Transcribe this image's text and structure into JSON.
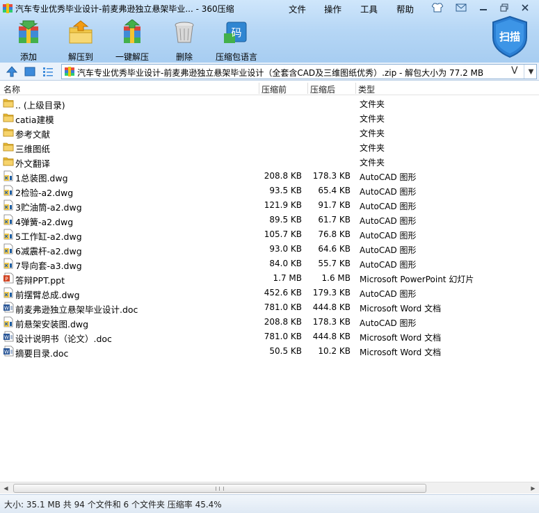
{
  "window": {
    "title": "汽车专业优秀毕业设计-前麦弗逊独立悬架毕业... - 360压缩",
    "menus": [
      "文件",
      "操作",
      "工具",
      "帮助"
    ]
  },
  "toolbar": {
    "add_label": "添加",
    "extract_to_label": "解压到",
    "one_click_label": "一键解压",
    "delete_label": "删除",
    "lang_label": "压缩包语言",
    "lang_icon_text": "码",
    "scan_label": "扫描"
  },
  "address": {
    "path": "汽车专业优秀毕业设计-前麦弗逊独立悬架毕业设计（全套含CAD及三维图纸优秀）.zip - 解包大小为 77.2 MB",
    "v_label": "V"
  },
  "columns": {
    "name": "名称",
    "before": "压缩前",
    "after": "压缩后",
    "type": "类型"
  },
  "rows": [
    {
      "icon": "folder",
      "name": ".. (上级目录)",
      "before": "",
      "after": "",
      "type": "文件夹"
    },
    {
      "icon": "folder",
      "name": "catia建模",
      "before": "",
      "after": "",
      "type": "文件夹"
    },
    {
      "icon": "folder",
      "name": "参考文献",
      "before": "",
      "after": "",
      "type": "文件夹"
    },
    {
      "icon": "folder",
      "name": "三维图纸",
      "before": "",
      "after": "",
      "type": "文件夹"
    },
    {
      "icon": "folder",
      "name": "外文翻译",
      "before": "",
      "after": "",
      "type": "文件夹"
    },
    {
      "icon": "dwg",
      "name": "1总装图.dwg",
      "before": "208.8 KB",
      "after": "178.3 KB",
      "type": "AutoCAD 图形"
    },
    {
      "icon": "dwg",
      "name": "2检验-a2.dwg",
      "before": "93.5 KB",
      "after": "65.4 KB",
      "type": "AutoCAD 图形"
    },
    {
      "icon": "dwg",
      "name": "3贮油筒-a2.dwg",
      "before": "121.9 KB",
      "after": "91.7 KB",
      "type": "AutoCAD 图形"
    },
    {
      "icon": "dwg",
      "name": "4弹簧-a2.dwg",
      "before": "89.5 KB",
      "after": "61.7 KB",
      "type": "AutoCAD 图形"
    },
    {
      "icon": "dwg",
      "name": "5工作缸-a2.dwg",
      "before": "105.7 KB",
      "after": "76.8 KB",
      "type": "AutoCAD 图形"
    },
    {
      "icon": "dwg",
      "name": "6减震杆-a2.dwg",
      "before": "93.0 KB",
      "after": "64.6 KB",
      "type": "AutoCAD 图形"
    },
    {
      "icon": "dwg",
      "name": "7导向套-a3.dwg",
      "before": "84.0 KB",
      "after": "55.7 KB",
      "type": "AutoCAD 图形"
    },
    {
      "icon": "ppt",
      "name": "答辩PPT.ppt",
      "before": "1.7 MB",
      "after": "1.6 MB",
      "type": "Microsoft PowerPoint 幻灯片"
    },
    {
      "icon": "dwg",
      "name": "前摆臂总成.dwg",
      "before": "452.6 KB",
      "after": "179.3 KB",
      "type": "AutoCAD 图形"
    },
    {
      "icon": "doc",
      "name": "前麦弗逊独立悬架毕业设计.doc",
      "before": "781.0 KB",
      "after": "444.8 KB",
      "type": "Microsoft Word 文档"
    },
    {
      "icon": "dwg",
      "name": "前悬架安装图.dwg",
      "before": "208.8 KB",
      "after": "178.3 KB",
      "type": "AutoCAD 图形"
    },
    {
      "icon": "doc",
      "name": "设计说明书（论文）.doc",
      "before": "781.0 KB",
      "after": "444.8 KB",
      "type": "Microsoft Word 文档"
    },
    {
      "icon": "doc",
      "name": "摘要目录.doc",
      "before": "50.5 KB",
      "after": "10.2 KB",
      "type": "Microsoft Word 文档"
    }
  ],
  "status": {
    "text": "大小: 35.1 MB 共 94 个文件和 6 个文件夹 压缩率 45.4%"
  },
  "colors": {
    "header_blue": "#b5d6f5",
    "folder_yellow": "#f2c94c",
    "scan_blue": "#2b7fd4"
  }
}
